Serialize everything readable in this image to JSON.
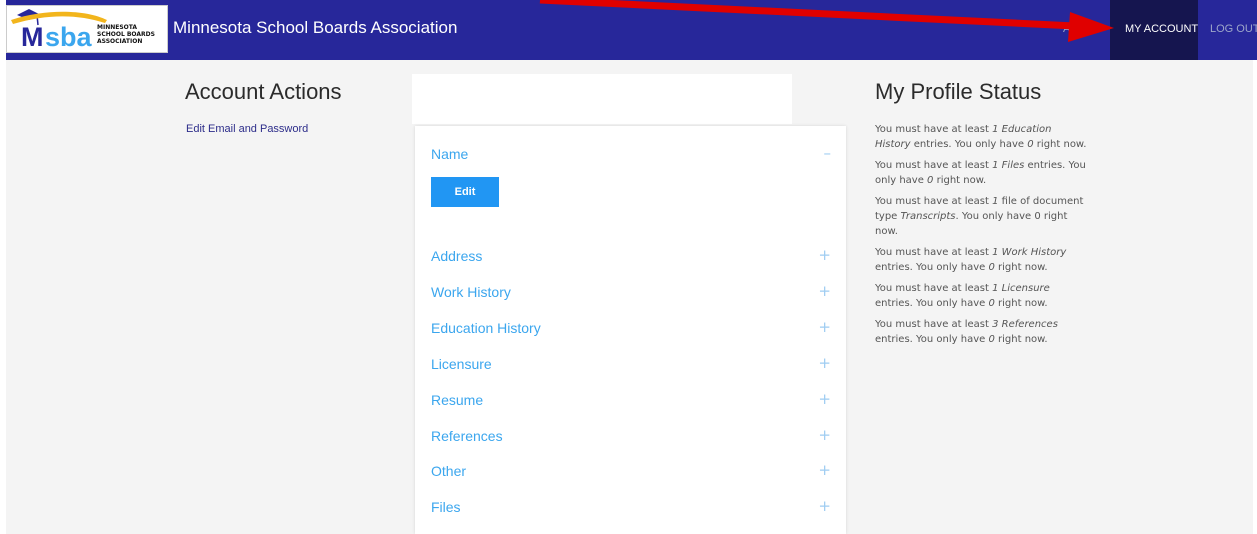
{
  "header": {
    "logo": {
      "main": "MSBA",
      "sub": [
        "MINNESOTA",
        "SCHOOL BOARDS",
        "ASSOCIATION"
      ]
    },
    "site_title": "Minnesota School Boards Association",
    "nav": {
      "apply": "APPLY",
      "my_account": "MY ACCOUNT",
      "logout": "LOG OUT"
    }
  },
  "account_actions": {
    "heading": "Account Actions",
    "link": "Edit Email and Password"
  },
  "accordion": {
    "sections": [
      {
        "label": "Name",
        "toggle": "–",
        "expanded": true
      },
      {
        "label": "Address",
        "toggle": "+"
      },
      {
        "label": "Work History",
        "toggle": "+"
      },
      {
        "label": "Education History",
        "toggle": "+"
      },
      {
        "label": "Licensure",
        "toggle": "+"
      },
      {
        "label": "Resume",
        "toggle": "+"
      },
      {
        "label": "References",
        "toggle": "+"
      },
      {
        "label": "Other",
        "toggle": "+"
      },
      {
        "label": "Files",
        "toggle": "+"
      }
    ],
    "edit_button": "Edit"
  },
  "profile_status": {
    "heading": "My Profile Status",
    "messages": [
      {
        "pre": "You must have at least ",
        "em": "1 Education History",
        "mid": " entries. You only have ",
        "count": "0",
        "post": " right now."
      },
      {
        "pre": "You must have at least ",
        "em": "1 Files",
        "mid": " entries. You only have ",
        "count": "0",
        "post": " right now."
      },
      {
        "pre": "You must have at least ",
        "em": "1",
        "mid": " file of document type ",
        "count": "Transcripts",
        "post": ". You only have 0 right now."
      },
      {
        "pre": "You must have at least ",
        "em": "1 Work History",
        "mid": " entries. You only have ",
        "count": "0",
        "post": " right now."
      },
      {
        "pre": "You must have at least ",
        "em": "1 Licensure",
        "mid": " entries. You only have ",
        "count": "0",
        "post": " right now."
      },
      {
        "pre": "You must have at least ",
        "em": "3 References",
        "mid": " entries. You only have ",
        "count": "0",
        "post": " right now."
      }
    ]
  },
  "colors": {
    "header_bg": "#27279a",
    "active_nav_bg": "#15154f",
    "accent": "#3ba6ee",
    "button": "#2196f3",
    "annotation_arrow": "#e00000"
  }
}
